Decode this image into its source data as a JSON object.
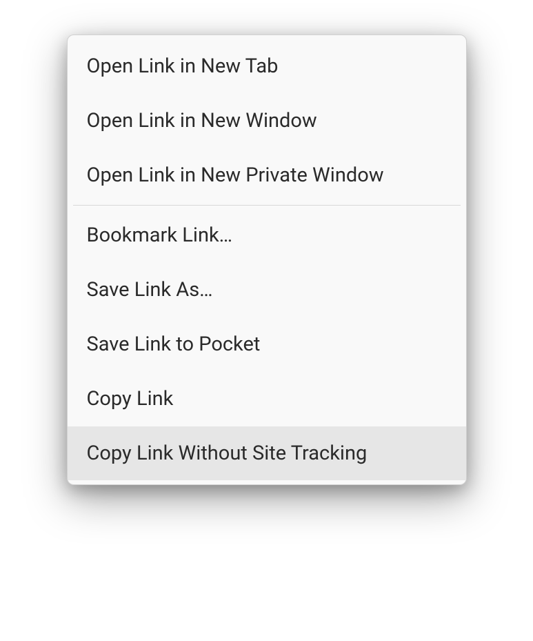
{
  "menu": {
    "groups": [
      {
        "items": [
          {
            "id": "open-new-tab",
            "label": "Open Link in New Tab",
            "highlighted": false
          },
          {
            "id": "open-new-window",
            "label": "Open Link in New Window",
            "highlighted": false
          },
          {
            "id": "open-private-window",
            "label": "Open Link in New Private Window",
            "highlighted": false
          }
        ]
      },
      {
        "items": [
          {
            "id": "bookmark-link",
            "label": "Bookmark Link…",
            "highlighted": false
          },
          {
            "id": "save-link-as",
            "label": "Save Link As…",
            "highlighted": false
          },
          {
            "id": "save-to-pocket",
            "label": "Save Link to Pocket",
            "highlighted": false
          },
          {
            "id": "copy-link",
            "label": "Copy Link",
            "highlighted": false
          },
          {
            "id": "copy-link-no-tracking",
            "label": "Copy Link Without Site Tracking",
            "highlighted": true
          }
        ]
      }
    ]
  }
}
